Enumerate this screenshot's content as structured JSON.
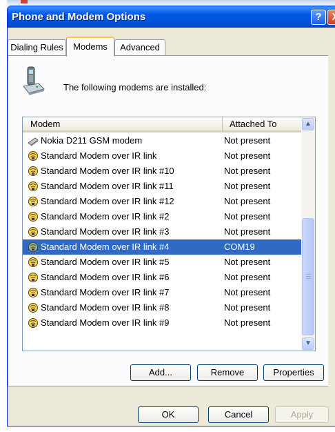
{
  "window": {
    "title": "Phone and Modem Options",
    "help_label": "?",
    "close_label": "X"
  },
  "tabs": [
    {
      "label": "Dialing Rules",
      "active": false
    },
    {
      "label": "Modems",
      "active": true
    },
    {
      "label": "Advanced",
      "active": false
    }
  ],
  "intro": {
    "text": "The following modems are installed:",
    "icon": "phone-modem-icon"
  },
  "list": {
    "columns": [
      "Modem",
      "Attached To"
    ],
    "rows": [
      {
        "name": "Nokia D211 GSM modem",
        "attached": "Not present",
        "icon": "modem-card-icon",
        "selected": false
      },
      {
        "name": "Standard Modem over IR link",
        "attached": "Not present",
        "icon": "ir-modem-icon",
        "selected": false
      },
      {
        "name": "Standard Modem over IR link #10",
        "attached": "Not present",
        "icon": "ir-modem-icon",
        "selected": false
      },
      {
        "name": "Standard Modem over IR link #11",
        "attached": "Not present",
        "icon": "ir-modem-icon",
        "selected": false
      },
      {
        "name": "Standard Modem over IR link #12",
        "attached": "Not present",
        "icon": "ir-modem-icon",
        "selected": false
      },
      {
        "name": "Standard Modem over IR link #2",
        "attached": "Not present",
        "icon": "ir-modem-icon",
        "selected": false
      },
      {
        "name": "Standard Modem over IR link #3",
        "attached": "Not present",
        "icon": "ir-modem-icon",
        "selected": false
      },
      {
        "name": "Standard Modem over IR link #4",
        "attached": "COM19",
        "icon": "ir-modem-icon",
        "selected": true
      },
      {
        "name": "Standard Modem over IR link #5",
        "attached": "Not present",
        "icon": "ir-modem-icon",
        "selected": false
      },
      {
        "name": "Standard Modem over IR link #6",
        "attached": "Not present",
        "icon": "ir-modem-icon",
        "selected": false
      },
      {
        "name": "Standard Modem over IR link #7",
        "attached": "Not present",
        "icon": "ir-modem-icon",
        "selected": false
      },
      {
        "name": "Standard Modem over IR link #8",
        "attached": "Not present",
        "icon": "ir-modem-icon",
        "selected": false
      },
      {
        "name": "Standard Modem over IR link #9",
        "attached": "Not present",
        "icon": "ir-modem-icon",
        "selected": false
      }
    ]
  },
  "buttons": {
    "add": "Add...",
    "remove": "Remove",
    "properties": "Properties",
    "ok": "OK",
    "cancel": "Cancel",
    "apply": "Apply"
  },
  "colors": {
    "titlebar": "#0054e3",
    "selection": "#316ac5",
    "dialog_bg": "#ece9d8"
  }
}
